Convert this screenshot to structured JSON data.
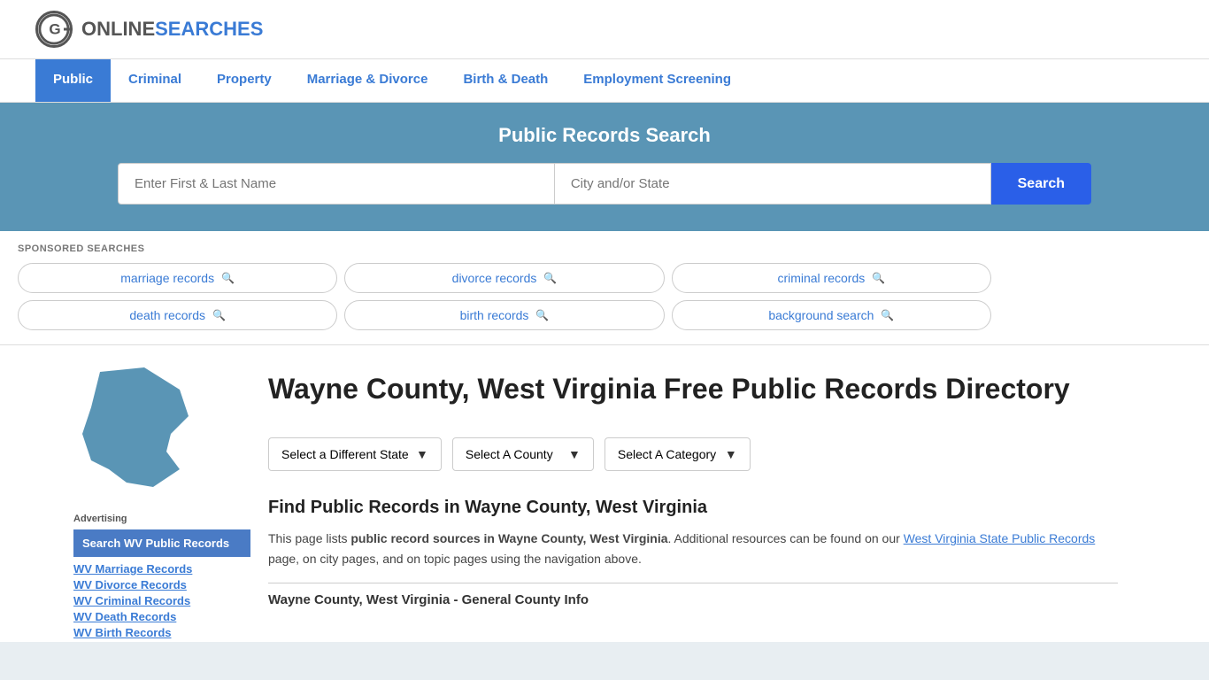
{
  "header": {
    "logo_text_online": "ONLINE",
    "logo_text_searches": "SEARCHES"
  },
  "nav": {
    "items": [
      {
        "label": "Public",
        "active": true
      },
      {
        "label": "Criminal",
        "active": false
      },
      {
        "label": "Property",
        "active": false
      },
      {
        "label": "Marriage & Divorce",
        "active": false
      },
      {
        "label": "Birth & Death",
        "active": false
      },
      {
        "label": "Employment Screening",
        "active": false
      }
    ]
  },
  "search_banner": {
    "title": "Public Records Search",
    "name_placeholder": "Enter First & Last Name",
    "location_placeholder": "City and/or State",
    "button_label": "Search"
  },
  "sponsored": {
    "label": "SPONSORED SEARCHES",
    "tags": [
      {
        "label": "marriage records"
      },
      {
        "label": "divorce records"
      },
      {
        "label": "criminal records"
      },
      {
        "label": "death records"
      },
      {
        "label": "birth records"
      },
      {
        "label": "background search"
      }
    ]
  },
  "sidebar": {
    "ad_label": "Advertising",
    "active_link": "Search WV Public Records",
    "links": [
      "WV Marriage Records",
      "WV Divorce Records",
      "WV Criminal Records",
      "WV Death Records",
      "WV Birth Records"
    ]
  },
  "main": {
    "page_title": "Wayne County, West Virginia Free Public Records Directory",
    "dropdowns": {
      "state": "Select a Different State",
      "county": "Select A County",
      "category": "Select A Category"
    },
    "find_title": "Find Public Records in Wayne County, West Virginia",
    "find_text_1": "This page lists ",
    "find_text_bold": "public record sources in Wayne County, West Virginia",
    "find_text_2": ". Additional resources can be found on our ",
    "find_link": "West Virginia State Public Records",
    "find_text_3": " page, on city pages, and on topic pages using the navigation above.",
    "county_info_title": "Wayne County, West Virginia - General County Info"
  }
}
